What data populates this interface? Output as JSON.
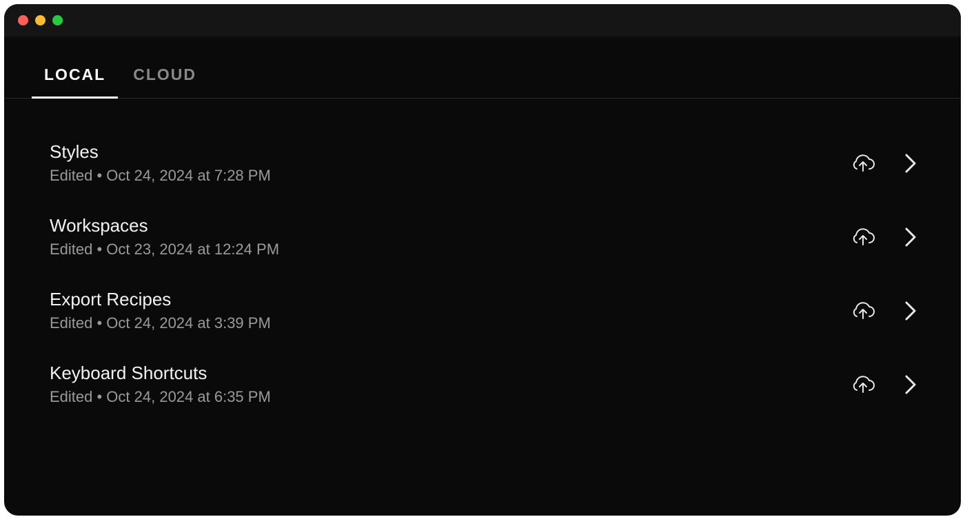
{
  "tabs": [
    {
      "label": "LOCAL",
      "active": true
    },
    {
      "label": "CLOUD",
      "active": false
    }
  ],
  "items": [
    {
      "title": "Styles",
      "subtitle": "Edited  •  Oct 24, 2024 at 7:28 PM"
    },
    {
      "title": "Workspaces",
      "subtitle": "Edited  •  Oct 23, 2024 at 12:24 PM"
    },
    {
      "title": "Export Recipes",
      "subtitle": "Edited  •  Oct 24, 2024 at 3:39 PM"
    },
    {
      "title": "Keyboard Shortcuts",
      "subtitle": "Edited  •  Oct 24, 2024 at 6:35 PM"
    }
  ]
}
